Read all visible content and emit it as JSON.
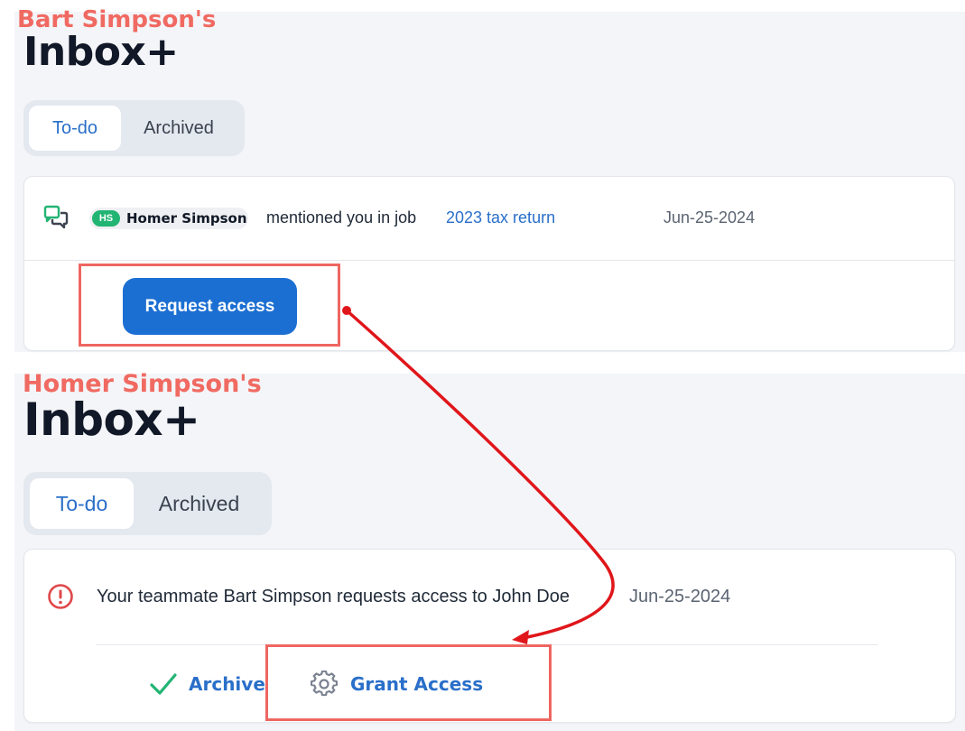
{
  "top_section": {
    "owner_label": "Bart Simpson's",
    "inbox_title": "Inbox+",
    "tabs": [
      {
        "label": "To-do",
        "active": true
      },
      {
        "label": "Archived",
        "active": false
      }
    ],
    "notification": {
      "icon": "chat-bubbles-icon",
      "user_initials": "HS",
      "user_name": "Homer Simpson",
      "action_text": "mentioned you in job",
      "job_link": "2023 tax return",
      "date": "Jun-25-2024",
      "button_label": "Request access"
    }
  },
  "bottom_section": {
    "owner_label": "Homer Simpson's",
    "inbox_title": "Inbox+",
    "tabs": [
      {
        "label": "To-do",
        "active": true
      },
      {
        "label": "Archived",
        "active": false
      }
    ],
    "notification": {
      "icon": "alert-circle-icon",
      "message": "Your teammate Bart Simpson requests access to John Doe",
      "date": "Jun-25-2024",
      "archive_label": "Archive",
      "grant_label": "Grant Access"
    }
  },
  "colors": {
    "annotation_red": "#ef6661",
    "arrow_red": "#e0161b",
    "primary_blue": "#1c6fd2",
    "link_blue": "#2a6fc9",
    "badge_green": "#22b473",
    "check_green": "#22b473",
    "panel_bg": "#f4f5f8"
  }
}
